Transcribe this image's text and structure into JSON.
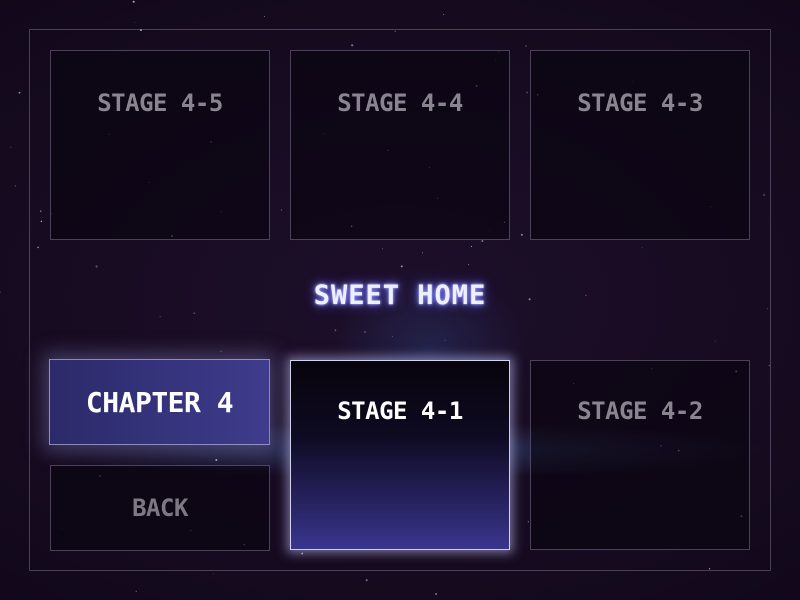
{
  "world_title": "SWEET HOME",
  "stages": {
    "s45": "STAGE 4-5",
    "s44": "STAGE 4-4",
    "s43": "STAGE 4-3",
    "s41": "STAGE 4-1",
    "s42": "STAGE 4-2"
  },
  "chapter_label": "CHAPTER 4",
  "back_label": "BACK",
  "colors": {
    "selected_accent": "#3e3c8c",
    "title_glow": "#8a8cff",
    "locked_text": "#8a8490"
  }
}
